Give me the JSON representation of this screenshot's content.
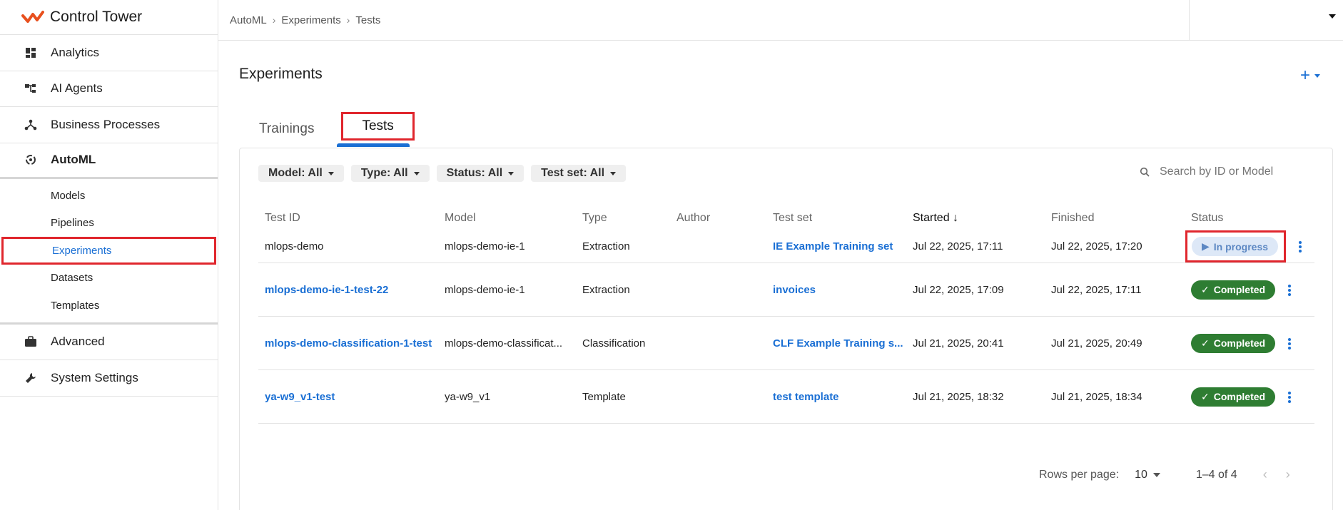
{
  "app": {
    "title": "Control Tower"
  },
  "sidebar": {
    "items": [
      {
        "label": "Analytics",
        "icon": "dashboard-icon"
      },
      {
        "label": "AI Agents",
        "icon": "hierarchy-icon"
      },
      {
        "label": "Business Processes",
        "icon": "process-icon"
      },
      {
        "label": "AutoML",
        "icon": "automl-icon"
      },
      {
        "label": "Advanced",
        "icon": "briefcase-icon"
      },
      {
        "label": "System Settings",
        "icon": "wrench-icon"
      }
    ],
    "automl_children": [
      "Models",
      "Pipelines",
      "Experiments",
      "Datasets",
      "Templates"
    ]
  },
  "breadcrumb": [
    "AutoML",
    "Experiments",
    "Tests"
  ],
  "page": {
    "title": "Experiments",
    "add_label": "+"
  },
  "tabs": [
    "Trainings",
    "Tests"
  ],
  "filters": [
    "Model: All",
    "Type: All",
    "Status: All",
    "Test set: All"
  ],
  "search": {
    "placeholder": "Search by ID or Model"
  },
  "table": {
    "headers": [
      "Test ID",
      "Model",
      "Type",
      "Author",
      "Test set",
      "Started",
      "Finished",
      "Status"
    ],
    "rows": [
      {
        "id": "mlops-demo",
        "model": "mlops-demo-ie-1",
        "type": "Extraction",
        "author": "",
        "testset": "IE Example Training set",
        "started": "Jul 22, 2025, 17:11",
        "finished": "Jul 22, 2025, 17:20",
        "status": "In progress"
      },
      {
        "id": "mlops-demo-ie-1-test-22",
        "model": "mlops-demo-ie-1",
        "type": "Extraction",
        "author": "",
        "testset": "invoices",
        "started": "Jul 22, 2025, 17:09",
        "finished": "Jul 22, 2025, 17:11",
        "status": "Completed"
      },
      {
        "id": "mlops-demo-classification-1-test",
        "model": "mlops-demo-classificat...",
        "type": "Classification",
        "author": "",
        "testset": "CLF Example Training s...",
        "started": "Jul 21, 2025, 20:41",
        "finished": "Jul 21, 2025, 20:49",
        "status": "Completed"
      },
      {
        "id": "ya-w9_v1-test",
        "model": "ya-w9_v1",
        "type": "Template",
        "author": "",
        "testset": "test template",
        "started": "Jul 21, 2025, 18:32",
        "finished": "Jul 21, 2025, 18:34",
        "status": "Completed"
      }
    ]
  },
  "pagination": {
    "rows_per_page_label": "Rows per page:",
    "rows_per_page": "10",
    "range": "1–4 of 4"
  },
  "colors": {
    "accent": "#1a6fd4",
    "success": "#2e7d32",
    "highlight": "#e0262d",
    "brand": "#e8501e"
  }
}
